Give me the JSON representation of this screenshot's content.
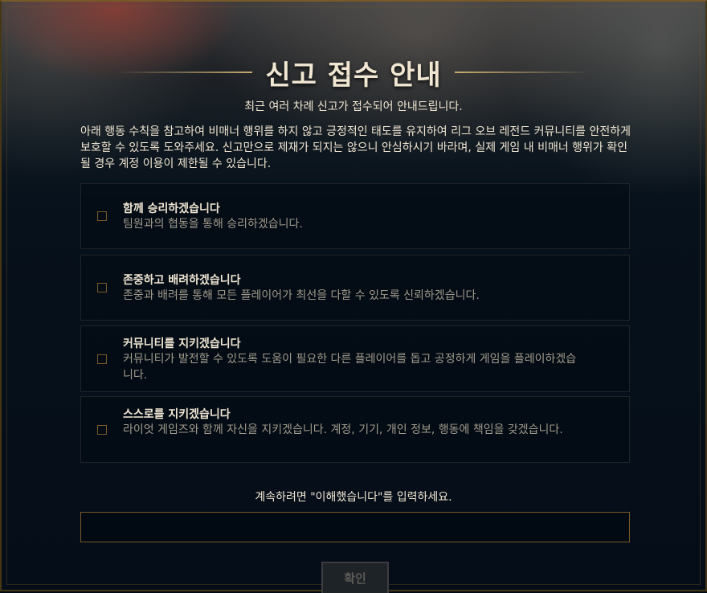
{
  "dialog": {
    "title": "신고 접수 안내",
    "subtitle": "최근 여러 차례 신고가 접수되어 안내드립니다.",
    "description": "아래 행동 수칙을 참고하여 비매너 행위를 하지 않고 긍정적인 태도를 유지하여 리그 오브 레전드 커뮤니티를 안전하게 보호할 수 있도록 도와주세요. 신고만으로 제재가 되지는 않으니 안심하시기 바라며, 실제 게임 내 비매너 행위가 확인될 경우 계정 이용이 제한될 수 있습니다.",
    "pledges": [
      {
        "title": "함께 승리하겠습니다",
        "description": "팀원과의 협동을 통해 승리하겠습니다.",
        "checked": false
      },
      {
        "title": "존중하고 배려하겠습니다",
        "description": "존중과 배려를 통해 모든 플레이어가 최선을 다할 수 있도록 신뢰하겠습니다.",
        "checked": false
      },
      {
        "title": "커뮤니티를 지키겠습니다",
        "description": "커뮤니티가 발전할 수 있도록 도움이 필요한 다른 플레이어를 돕고 공정하게 게임을 플레이하겠습니다.",
        "checked": false
      },
      {
        "title": "스스로를 지키겠습니다",
        "description": "라이엇 게임즈와 함께 자신을 지키겠습니다. 계정, 기기, 개인 정보, 행동에 책임을 갖겠습니다.",
        "checked": false
      }
    ],
    "instruction": "계속하려면 \"이해했습니다\"를 입력하세요.",
    "input_value": "",
    "confirm_label": "확인"
  },
  "colors": {
    "gold": "#c8aa6e",
    "gold_dark": "#785a28",
    "text_light": "#f0e6d2",
    "text_muted": "#a09b8c",
    "background": "#010a13",
    "button_disabled_text": "#5c5b57"
  }
}
